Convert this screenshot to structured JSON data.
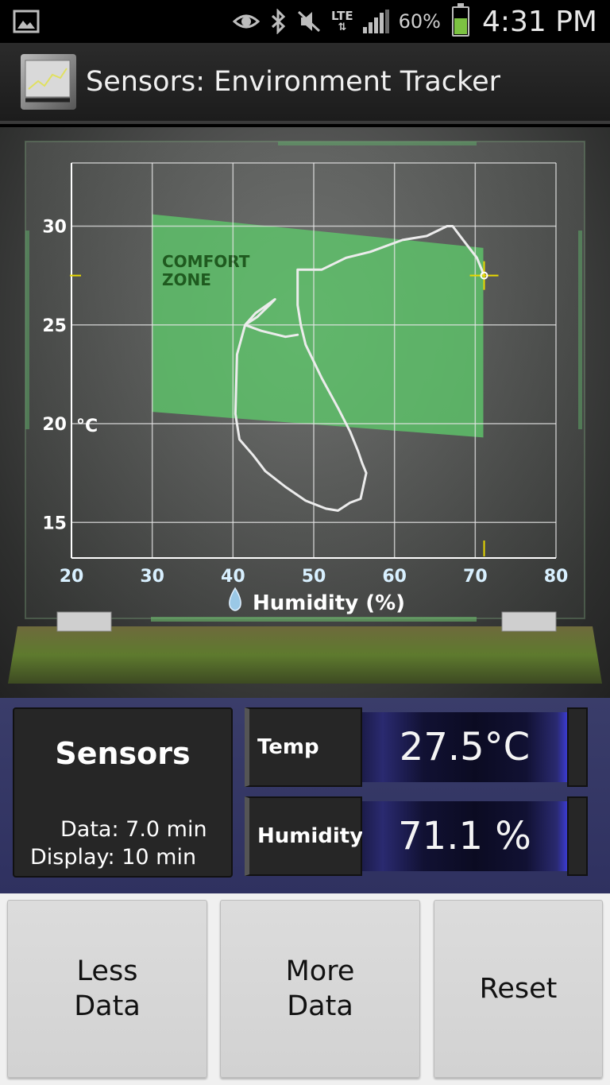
{
  "status_bar": {
    "battery_percent": "60%",
    "clock": "4:31 PM",
    "network": "LTE",
    "icons": [
      "gallery-icon",
      "eye-icon",
      "bluetooth-icon",
      "mute-icon",
      "lte-icon",
      "signal-icon",
      "battery-icon"
    ]
  },
  "app": {
    "title": "Sensors: Environment Tracker",
    "icon": "sensors-app-icon"
  },
  "chart_data": {
    "type": "line",
    "title": "",
    "xlabel": "Humidity (%)",
    "ylabel_unit": "°C",
    "xlim": [
      20,
      80
    ],
    "ylim": [
      13.2,
      33.2
    ],
    "x_ticks": [
      "20",
      "30",
      "40",
      "50",
      "60",
      "70",
      "80"
    ],
    "y_ticks": [
      "15",
      "20",
      "25",
      "30"
    ],
    "grid": true,
    "comfort_zone": {
      "label_line1": "COMFORT",
      "label_line2": "ZONE",
      "polygon": [
        [
          30,
          30.6
        ],
        [
          71,
          28.9
        ],
        [
          71,
          19.3
        ],
        [
          30,
          20.6
        ]
      ],
      "color": "#5ec46a"
    },
    "current_point": {
      "x": 71.1,
      "y": 27.5
    },
    "series": [
      {
        "x": [
          71.1,
          70.2,
          68.5,
          67.2,
          66.5,
          64.0,
          61.0,
          57.0,
          54.0,
          51.0,
          48.0,
          48.0,
          48.4,
          49.0,
          51.0,
          53.0,
          54.5,
          55.5,
          56.0,
          56.5,
          55.8,
          54.5,
          53.0,
          51.5,
          49.0,
          46.5,
          44.0,
          42.5,
          40.8,
          40.3,
          40.5,
          41.5,
          43.0,
          44.5,
          45.2,
          44.2,
          42.8,
          41.5,
          43.5,
          46.5,
          48.0
        ],
        "y": [
          27.5,
          28.4,
          29.3,
          30.0,
          30.0,
          29.5,
          29.3,
          28.7,
          28.4,
          27.8,
          27.8,
          26.0,
          25.0,
          24.0,
          22.3,
          20.8,
          19.6,
          18.6,
          18.0,
          17.5,
          16.2,
          16.0,
          15.6,
          15.7,
          16.1,
          16.8,
          17.6,
          18.4,
          19.2,
          20.5,
          23.5,
          25.0,
          25.4,
          26.0,
          26.3,
          26.0,
          25.6,
          25.0,
          24.7,
          24.4,
          24.5
        ],
        "color": "#ececec"
      }
    ]
  },
  "readout": {
    "title": "Sensors",
    "data_line": "Data: 7.0 min",
    "display_line": "Display: 10 min",
    "temp_label": "Temp",
    "temp_value": "27.5°C",
    "humidity_label": "Humidity",
    "humidity_value": "71.1 %"
  },
  "buttons": {
    "less_line1": "Less",
    "less_line2": "Data",
    "more_line1": "More",
    "more_line2": "Data",
    "reset": "Reset"
  }
}
